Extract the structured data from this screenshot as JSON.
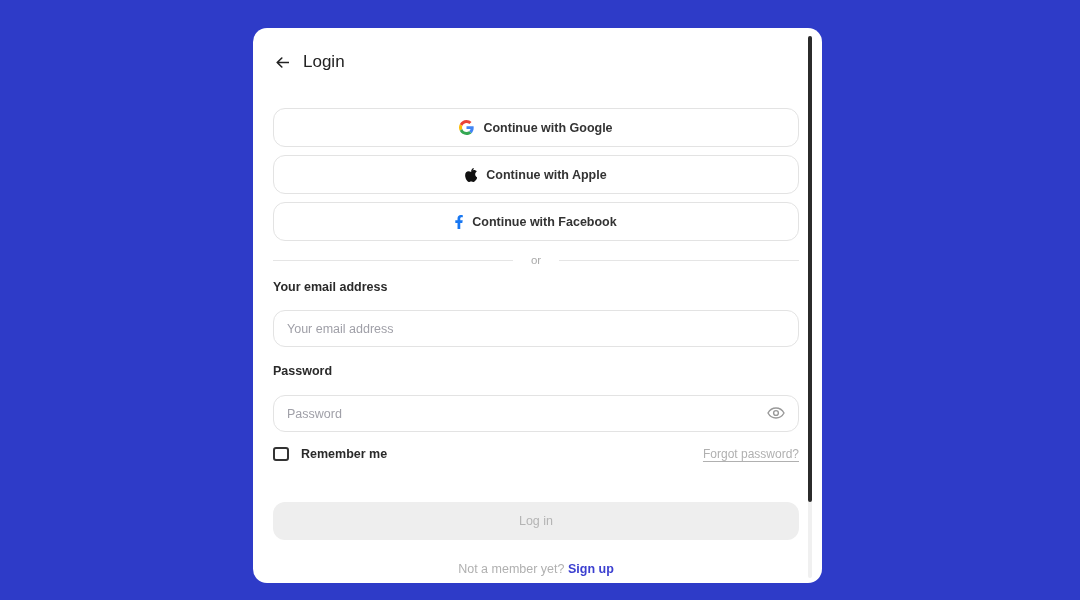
{
  "header": {
    "title": "Login"
  },
  "social_buttons": [
    {
      "kind": "google",
      "label": "Continue with Google"
    },
    {
      "kind": "apple",
      "label": "Continue with Apple"
    },
    {
      "kind": "facebook",
      "label": "Continue with Facebook"
    }
  ],
  "divider": {
    "text": "or"
  },
  "fields": [
    {
      "kind": "email",
      "label": "Your email address",
      "placeholder": "Your email address"
    },
    {
      "kind": "password",
      "label": "Password",
      "placeholder": "Password"
    }
  ],
  "remember": {
    "label": "Remember me",
    "checked": false
  },
  "forgot_link": "Forgot password?",
  "submit": {
    "label": "Log in",
    "disabled": true
  },
  "footer": {
    "text": "Not a member yet?",
    "link": "Sign up"
  }
}
